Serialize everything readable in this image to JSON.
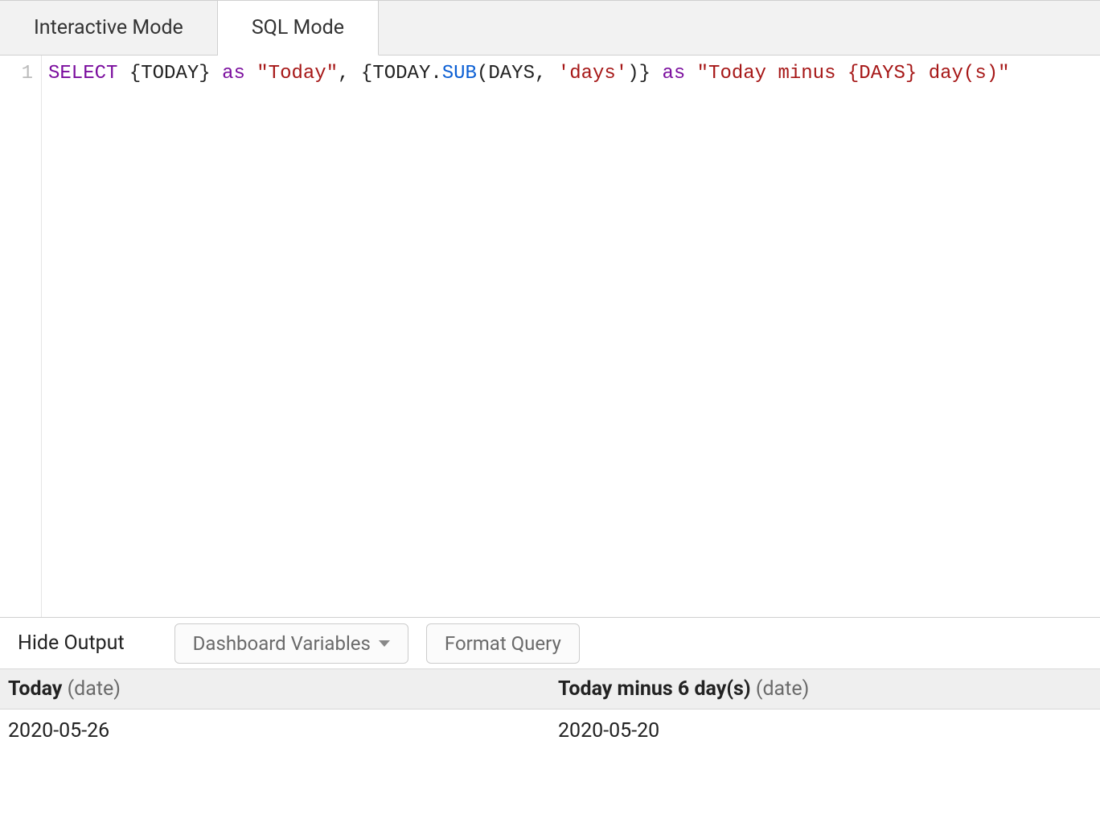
{
  "tabs": {
    "interactive": "Interactive Mode",
    "sql": "SQL Mode"
  },
  "editor": {
    "line_number": "1",
    "tokens": {
      "select": "SELECT",
      "sp": " ",
      "lb1": "{",
      "today1": "TODAY",
      "rb1": "}",
      "as1": "as",
      "str_today": "\"Today\"",
      "comma": ",",
      "lb2": "{",
      "today2": "TODAY",
      "dot": ".",
      "sub": "SUB",
      "lp": "(",
      "days_arg": "DAYS",
      "comma2": ",",
      "str_days": "'days'",
      "rp": ")",
      "rb2": "}",
      "as2": "as",
      "str_minus": "\"Today minus {DAYS} day(s)\""
    }
  },
  "bottom": {
    "hide_output": "Hide Output",
    "dashboard_vars": "Dashboard Variables",
    "format_query": "Format Query"
  },
  "results": {
    "columns": [
      {
        "name": "Today",
        "type": "(date)"
      },
      {
        "name": "Today minus 6 day(s)",
        "type": "(date)"
      }
    ],
    "rows": [
      {
        "c0": "2020-05-26",
        "c1": "2020-05-20"
      }
    ]
  }
}
